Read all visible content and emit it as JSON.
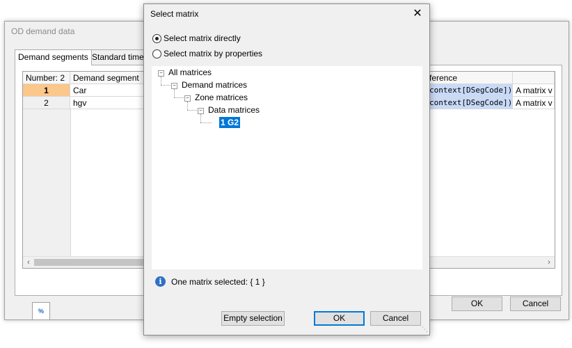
{
  "background_window": {
    "title": "OD demand data",
    "tabs": [
      {
        "label": "Demand segments"
      },
      {
        "label": "Standard time se"
      }
    ],
    "grid": {
      "header": {
        "number": "Number: 2",
        "segment": "Demand segment",
        "reference": "ference"
      },
      "rows": [
        {
          "num": "1",
          "segment": "Car",
          "reference": "context[DSegCode])",
          "extra": "A matrix v"
        },
        {
          "num": "2",
          "segment": "hgv",
          "reference": "context[DSegCode])",
          "extra": "A matrix v"
        }
      ]
    },
    "icon_button_glyph": "%",
    "ok_label": "OK",
    "cancel_label": "Cancel"
  },
  "dialog": {
    "title": "Select matrix",
    "radio_direct": "Select matrix directly",
    "radio_properties": "Select matrix by properties",
    "tree": {
      "root": "All matrices",
      "demand": "Demand matrices",
      "zone": "Zone matrices",
      "data": "Data matrices",
      "selected": "1 G2"
    },
    "info_text": "One matrix selected: { 1 }",
    "empty_selection_label": "Empty selection",
    "ok_label": "OK",
    "cancel_label": "Cancel"
  },
  "colors": {
    "selection": "#0078d7",
    "row_highlight": "#fbc78b",
    "reference_cell": "#c9daf8"
  }
}
